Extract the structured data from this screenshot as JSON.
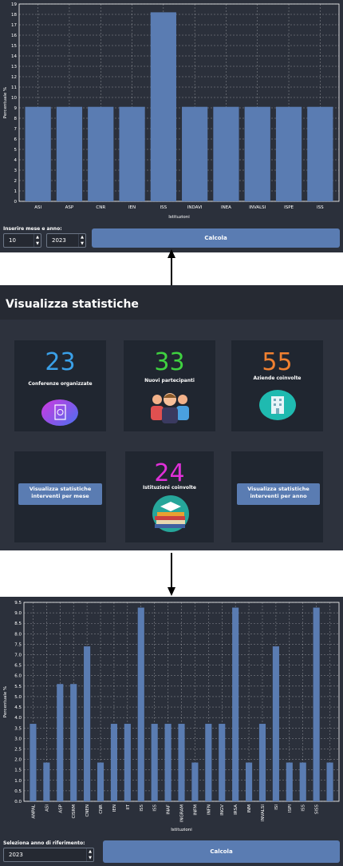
{
  "top_panel": {
    "chart_data": {
      "type": "bar",
      "categories": [
        "ASI",
        "ASP",
        "CNR",
        "IEN",
        "ISS",
        "INDAVI",
        "INEA",
        "INVALSI",
        "ISPE",
        "ISS"
      ],
      "values": [
        9.1,
        9.1,
        9.1,
        9.1,
        18.2,
        9.1,
        9.1,
        9.1,
        9.1,
        9.1
      ],
      "xlabel": "Istituzioni",
      "ylabel": "Percentuale %",
      "ylim": [
        0,
        19
      ],
      "yticks": [
        "0",
        "1",
        "2",
        "3",
        "4",
        "5",
        "6",
        "7",
        "8",
        "9",
        "10",
        "11",
        "12",
        "13",
        "14",
        "15",
        "16",
        "17",
        "18",
        "19"
      ],
      "grid": true,
      "bar_color": "#5a7cb2"
    },
    "label": "Inserire mese e anno:",
    "month_value": "10",
    "year_value": "2023",
    "button_label": "Calcola"
  },
  "mid_panel": {
    "title": "Visualizza statistiche",
    "cards": [
      {
        "number": "23",
        "label": "Conferenze organizzate",
        "color": "#3aa0e8",
        "icon": "certificate-icon"
      },
      {
        "number": "33",
        "label": "Nuovi partecipanti",
        "color": "#3fd140",
        "icon": "people-icon"
      },
      {
        "number": "55",
        "label": "Aziende coinvolte",
        "color": "#f08030",
        "icon": "building-icon"
      },
      {
        "number": "24",
        "label": "Istituzioni coinvolte",
        "color": "#e030d8",
        "icon": "books-icon"
      }
    ],
    "btn_month_label": "Visualizza statistiche interventi per mese",
    "btn_year_label": "Visualizza statistiche interventi per anno"
  },
  "bottom_panel": {
    "chart_data": {
      "type": "bar",
      "categories": [
        "ANPAL",
        "ASI",
        "ASP",
        "CISRM",
        "CNEN",
        "CNR",
        "IEN",
        "IIT",
        "ISS",
        "ISS",
        "INAF",
        "INGRAM",
        "INFM",
        "INFN",
        "INGV",
        "IRSA",
        "INM",
        "INVALSI",
        "ISI",
        "ISPI",
        "ISS",
        "SISS"
      ],
      "values": [
        3.7,
        1.85,
        5.6,
        5.6,
        7.4,
        1.85,
        3.7,
        3.7,
        9.25,
        3.7,
        3.7,
        3.7,
        1.85,
        3.7,
        3.7,
        9.25,
        1.85,
        3.7,
        7.4,
        1.85,
        1.85,
        9.25,
        1.85
      ],
      "xlabel": "Istituzioni",
      "ylabel": "Percentuale %",
      "ylim": [
        0,
        9.5
      ],
      "yticks": [
        "0.0",
        "0.5",
        "1.0",
        "1.5",
        "2.0",
        "2.5",
        "3.0",
        "3.5",
        "4.0",
        "4.5",
        "5.0",
        "5.5",
        "6.0",
        "6.5",
        "7.0",
        "7.5",
        "8.0",
        "8.5",
        "9.0",
        "9.5"
      ],
      "grid": true,
      "bar_color": "#5a7cb2"
    },
    "label": "Seleziona anno di riferimento:",
    "year_value": "2023",
    "button_label": "Calcola"
  }
}
